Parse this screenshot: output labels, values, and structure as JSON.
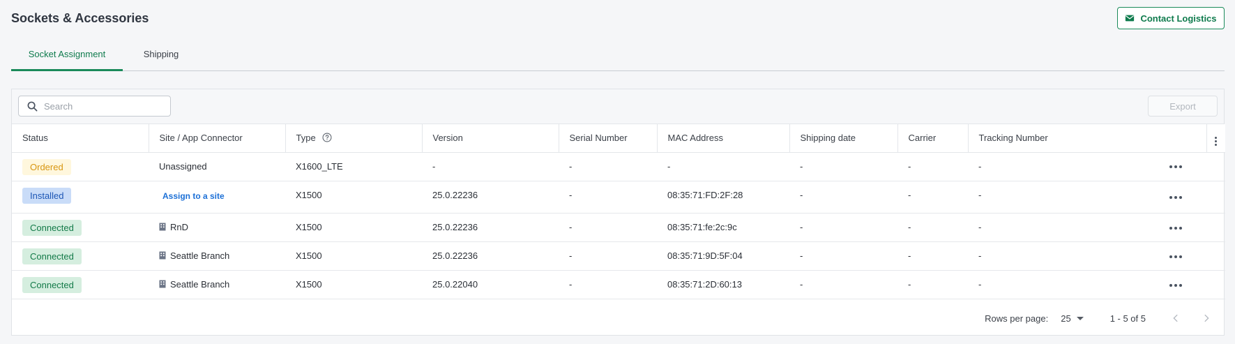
{
  "header": {
    "title": "Sockets & Accessories",
    "contact_button": "Contact Logistics"
  },
  "tabs": [
    {
      "label": "Socket Assignment",
      "active": true
    },
    {
      "label": "Shipping",
      "active": false
    }
  ],
  "toolbar": {
    "search_placeholder": "Search",
    "search_value": "",
    "export_label": "Export"
  },
  "table": {
    "columns": [
      "Status",
      "Site / App Connector",
      "Type",
      "Version",
      "Serial Number",
      "MAC Address",
      "Shipping date",
      "Carrier",
      "Tracking Number"
    ],
    "rows": [
      {
        "status": "Ordered",
        "site": "Unassigned",
        "type": "X1600_LTE",
        "version": "-",
        "serial": "-",
        "mac": "-",
        "shipping_date": "-",
        "carrier": "-",
        "tracking": "-"
      },
      {
        "status": "Installed",
        "site": "Assign to a site",
        "type": "X1500",
        "version": "25.0.22236",
        "serial": "-",
        "mac": "08:35:71:FD:2F:28",
        "shipping_date": "-",
        "carrier": "-",
        "tracking": "-"
      },
      {
        "status": "Connected",
        "site": "RnD",
        "type": "X1500",
        "version": "25.0.22236",
        "serial": "-",
        "mac": "08:35:71:fe:2c:9c",
        "shipping_date": "-",
        "carrier": "-",
        "tracking": "-"
      },
      {
        "status": "Connected",
        "site": "Seattle Branch",
        "type": "X1500",
        "version": "25.0.22236",
        "serial": "-",
        "mac": "08:35:71:9D:5F:04",
        "shipping_date": "-",
        "carrier": "-",
        "tracking": "-"
      },
      {
        "status": "Connected",
        "site": "Seattle Branch",
        "type": "X1500",
        "version": "25.0.22040",
        "serial": "-",
        "mac": "08:35:71:2D:60:13",
        "shipping_date": "-",
        "carrier": "-",
        "tracking": "-"
      }
    ]
  },
  "pagination": {
    "rows_per_page_label": "Rows per page:",
    "rows_per_page": "25",
    "range": "1 - 5 of 5"
  },
  "icons": {
    "contact": "mail-icon",
    "search": "search-icon",
    "type_info": "help-circle-icon",
    "site": "building-icon",
    "row_actions": "more-horizontal-icon",
    "column_menu": "more-vertical-icon",
    "prev": "chevron-left-icon",
    "next": "chevron-right-icon"
  },
  "colors": {
    "accent": "#1a8a5a",
    "link": "#1b6fd6",
    "ordered_bg": "#fff7dd",
    "ordered_fg": "#d89611",
    "installed_bg": "#c9dcf8",
    "installed_fg": "#1c56b5",
    "connected_bg": "#d5eedf",
    "connected_fg": "#137a48"
  }
}
